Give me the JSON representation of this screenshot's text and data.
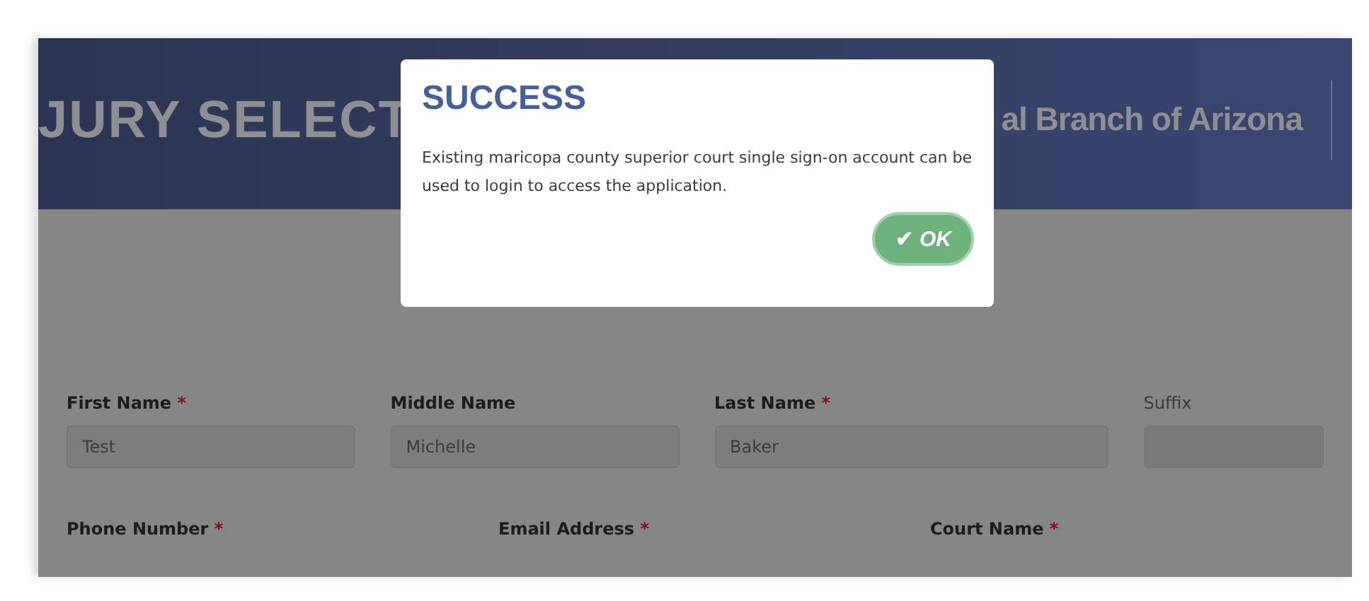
{
  "header": {
    "title": "JURY SELECT",
    "subtitle": "al Branch of Arizona"
  },
  "dialog": {
    "title": "SUCCESS",
    "message": "Existing maricopa county superior court single sign-on account can be used to login to access the application.",
    "button": {
      "icon": "✔",
      "label": "OK"
    }
  },
  "form_rows": [
    {
      "fields": [
        {
          "label": "First Name",
          "mark": "*",
          "value": "Test",
          "disabled": false
        },
        {
          "label": "Middle Name",
          "value": "Michelle",
          "disabled": false
        },
        {
          "label": "Last Name",
          "mark": "*",
          "value": "Baker",
          "disabled": false
        },
        {
          "label": "Suffix",
          "disabled": true
        }
      ]
    },
    {
      "fields": [
        {
          "label": "Phone Number",
          "mark": "*",
          "disabled": false
        },
        {
          "label": "Email Address",
          "mark": "*",
          "disabled": false
        },
        {
          "label": "Court Name",
          "mark": "*",
          "disabled": false
        }
      ]
    }
  ]
}
